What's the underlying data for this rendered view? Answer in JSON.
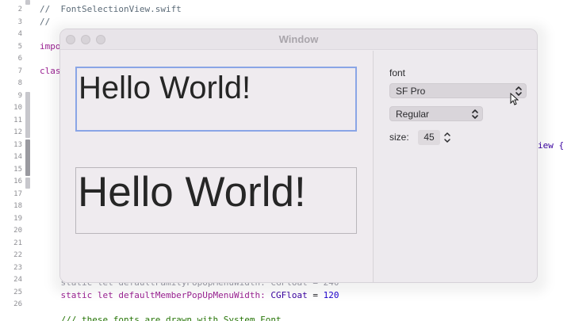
{
  "editor": {
    "line_numbers": [
      "2",
      "3",
      "4",
      "5",
      "6",
      "7",
      "8",
      "9",
      "10",
      "11",
      "12",
      "13",
      "14",
      "15",
      "16",
      "17",
      "18",
      "19",
      "20",
      "21",
      "22",
      "23",
      "24",
      "25",
      "26"
    ],
    "lines": {
      "l2": "//  FontSelectionView.swift",
      "l3": "//",
      "l5": "impo",
      "l7": "clas",
      "l13_tail": "iew {",
      "l24": "    static let defaultFamilyPopUpMenuWidth: CGFloat = 240",
      "l25_a": "    static let defaultMemberPopUpMenuWidth: ",
      "l25_b": "CGFloat",
      "l25_c": " = ",
      "l25_d": "120",
      "l27": "    /// these fonts are drawn with System Font"
    }
  },
  "window": {
    "title": "Window",
    "preview_top_text": "Hello World!",
    "preview_bottom_text": "Hello World!",
    "font_label": "font",
    "family_value": "SF Pro",
    "style_value": "Regular",
    "size_label": "size:",
    "size_value": "45"
  }
}
